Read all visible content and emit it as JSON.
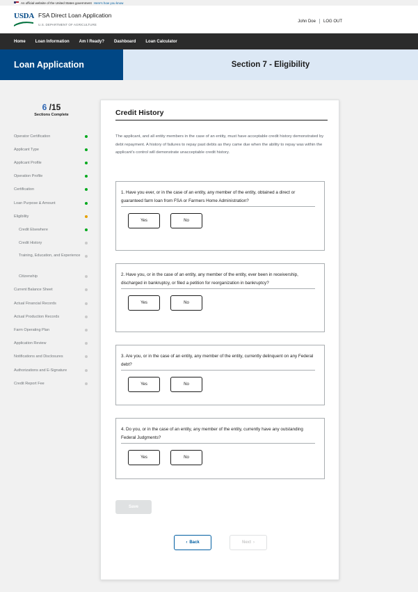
{
  "gov_banner": {
    "text": "An official website of the United States government",
    "link": "Here's how you know"
  },
  "header": {
    "logo_text": "USDA",
    "app_title": "FSA Direct Loan Application",
    "department": "U.S. DEPARTMENT OF AGRICULTURE",
    "user_name": "John Doe",
    "logout_label": "LOG OUT"
  },
  "nav": {
    "items": [
      "Home",
      "Loan Information",
      "Am I Ready?",
      "Dashboard",
      "Loan Calculator"
    ]
  },
  "hero": {
    "left_title": "Loan Application",
    "section_title": "Section 7 - Eligibility"
  },
  "progress": {
    "current": "6",
    "total": "/15",
    "label": "Sections Complete"
  },
  "steps": [
    {
      "label": "Operator Certification",
      "status": "complete"
    },
    {
      "label": "Applicant Type",
      "status": "complete"
    },
    {
      "label": "Applicant Profile",
      "status": "complete"
    },
    {
      "label": "Operation Profile",
      "status": "complete"
    },
    {
      "label": "Certification",
      "status": "complete"
    },
    {
      "label": "Loan Purpose & Amount",
      "status": "complete"
    },
    {
      "label": "Eligibility",
      "status": "in-progress"
    },
    {
      "label": "Credit Elsewhere",
      "status": "complete"
    },
    {
      "label": "Credit History",
      "status": "incomplete"
    },
    {
      "label": "Training, Education, and Experience",
      "status": "incomplete"
    },
    {
      "label": "Citizenship",
      "status": "incomplete"
    },
    {
      "label": "Current Balance Sheet",
      "status": "incomplete"
    },
    {
      "label": "Actual Financial Records",
      "status": "incomplete"
    },
    {
      "label": "Actual Production Records",
      "status": "incomplete"
    },
    {
      "label": "Farm Operating Plan",
      "status": "incomplete"
    },
    {
      "label": "Application Review",
      "status": "incomplete"
    },
    {
      "label": "Notifications and Disclosures",
      "status": "incomplete"
    },
    {
      "label": "Authorizations and E-Signature",
      "status": "incomplete"
    },
    {
      "label": "Credit Report Fee",
      "status": "incomplete"
    }
  ],
  "main": {
    "title": "Credit History",
    "intro": "The applicant, and all entity members in the case of an entity, must have acceptable credit history demonstrated by debt repayment. A history of failures to repay past debts as they came due when the ability to repay was within the applicant's control will demonstrate unacceptable credit history.",
    "questions": [
      {
        "text": "1. Have you ever, or in the case of an entity, any member of the entity, obtained a direct or guaranteed farm loan from FSA or Farmers Home Administration?",
        "yes": "Yes",
        "no": "No"
      },
      {
        "text": "2. Have you, or in the case of an entity, any member of the entity, ever been in receivership, discharged in bankruptcy, or filed a petition for reorganization in bankruptcy?",
        "yes": "Yes",
        "no": "No"
      },
      {
        "text": "3. Are you, or in the case of an entity, any member of the entity, currently delinquent on any Federal debt?",
        "yes": "Yes",
        "no": "No"
      },
      {
        "text": "4. Do you, or in the case of an entity, any member of the entity, currently have any outstanding Federal Judgments?",
        "yes": "Yes",
        "no": "No"
      }
    ],
    "save_label": "Save",
    "back_label": "Back",
    "next_label": "Next"
  },
  "colors": {
    "primary": "#004785",
    "hero_light": "#dce8f5",
    "nav_bg": "#2b2b2b",
    "complete": "#00a91c",
    "in_progress": "#e5a000",
    "incomplete": "#c9c9c9",
    "link": "#005ea2"
  }
}
